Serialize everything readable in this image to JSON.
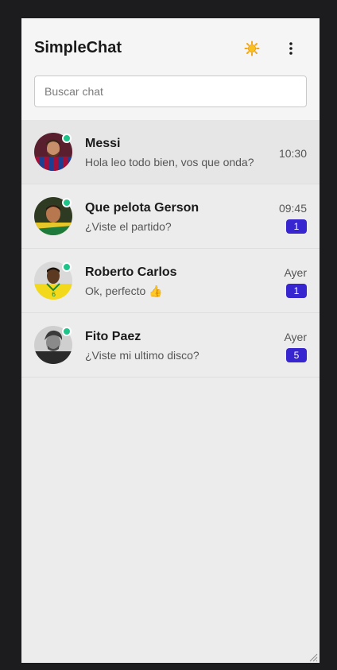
{
  "app": {
    "title": "SimpleChat"
  },
  "header": {
    "theme_icon": "sun-icon",
    "menu_icon": "more-vertical-icon"
  },
  "search": {
    "placeholder": "Buscar chat",
    "value": ""
  },
  "colors": {
    "accent": "#3726cf",
    "online": "#1ec48a",
    "background": "#ececec"
  },
  "chats": [
    {
      "name": "Messi",
      "preview": "Hola leo todo bien, vos que onda?",
      "time": "10:30",
      "unread": null,
      "online": true,
      "active": true
    },
    {
      "name": "Que pelota Gerson",
      "preview": "¿Viste el partido?",
      "time": "09:45",
      "unread": "1",
      "online": true,
      "active": false
    },
    {
      "name": "Roberto Carlos",
      "preview": "Ok, perfecto 👍",
      "time": "Ayer",
      "unread": "1",
      "online": true,
      "active": false
    },
    {
      "name": "Fito Paez",
      "preview": "¿Viste mi ultimo disco?",
      "time": "Ayer",
      "unread": "5",
      "online": true,
      "active": false
    }
  ]
}
